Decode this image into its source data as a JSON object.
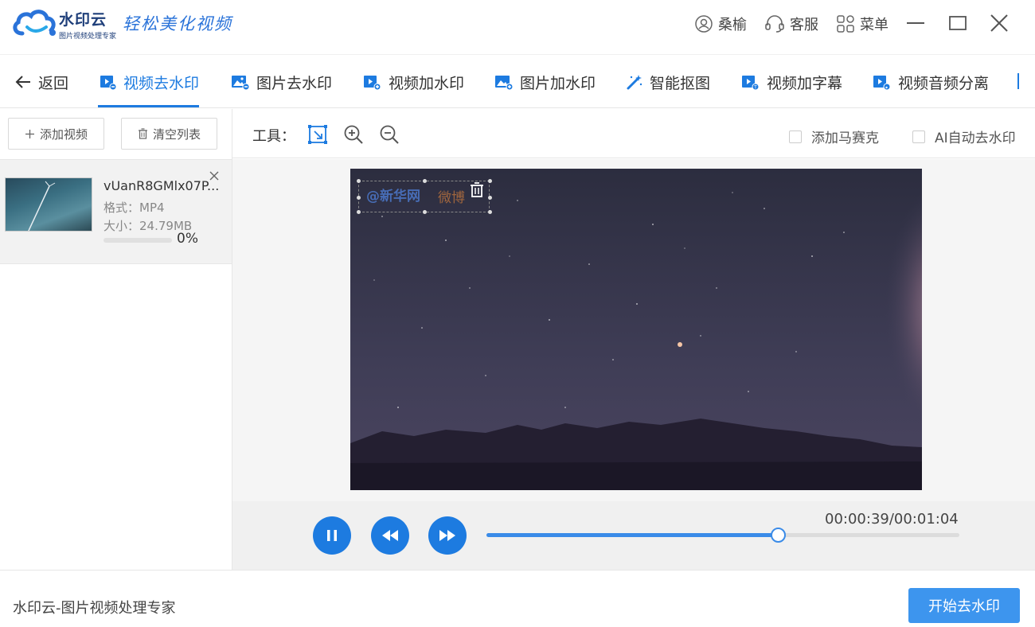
{
  "app": {
    "brand_name": "水印云",
    "brand_sub": "图片视频处理专家",
    "slogan": "轻松美化视频"
  },
  "titlebar": {
    "user_label": "桑榆",
    "support_label": "客服",
    "menu_label": "菜单"
  },
  "nav": {
    "back_label": "返回",
    "items": [
      {
        "label": "视频去水印",
        "icon": "video-erase-icon",
        "active": true
      },
      {
        "label": "图片去水印",
        "icon": "image-erase-icon"
      },
      {
        "label": "视频加水印",
        "icon": "video-add-icon"
      },
      {
        "label": "图片加水印",
        "icon": "image-add-icon"
      },
      {
        "label": "智能抠图",
        "icon": "magic-wand-icon"
      },
      {
        "label": "视频加字幕",
        "icon": "video-subtitle-icon"
      },
      {
        "label": "视频音频分离",
        "icon": "video-audio-icon"
      }
    ]
  },
  "left": {
    "add_video_label": "添加视频",
    "clear_list_label": "清空列表",
    "files": [
      {
        "name": "vUanR8GMlx07P...",
        "format": "格式：MP4",
        "size": "大小：24.79MB",
        "progress": "0%",
        "progress_value": 0
      }
    ]
  },
  "tools": {
    "label": "工具：",
    "mosaic_label": "添加马赛克",
    "ai_label": "AI自动去水印"
  },
  "video": {
    "watermark_text": "@新华网",
    "watermark_weibo": "微博"
  },
  "player": {
    "time": "00:00:39/00:01:04",
    "progress_fraction": 0.617
  },
  "footer": {
    "text": "水印云-图片视频处理专家",
    "start_label": "开始去水印"
  },
  "colors": {
    "accent": "#1d7be0",
    "button": "#3d95ee"
  }
}
